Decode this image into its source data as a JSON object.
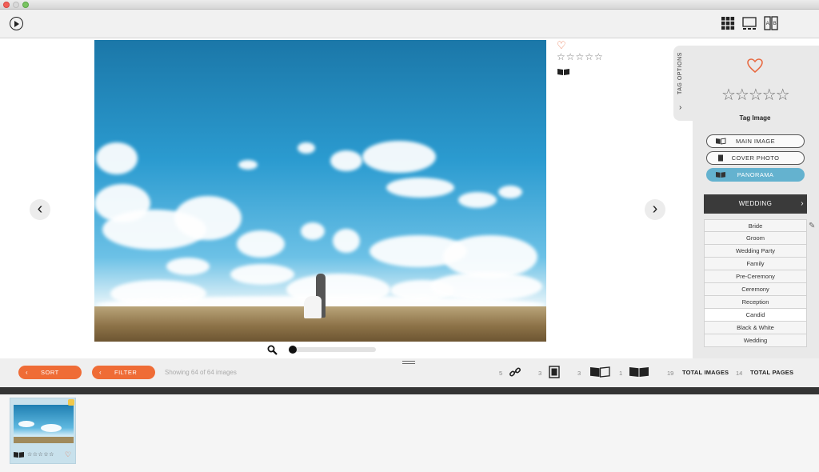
{
  "toolbar": {
    "play_icon": "play-icon",
    "view_icons": [
      "grid-view-icon",
      "single-view-icon",
      "compare-view-icon"
    ]
  },
  "viewer": {
    "prev_arrow": "‹",
    "next_arrow": "›",
    "heart": "♡",
    "stars": "☆☆☆☆☆",
    "zoom_level": 0
  },
  "tag_panel": {
    "tab_label": "TAG OPTIONS",
    "tab_chevron": "›",
    "stars": "☆☆☆☆☆",
    "tag_image_label": "Tag Image",
    "buttons": [
      {
        "label": "MAIN IMAGE"
      },
      {
        "label": "COVER PHOTO"
      },
      {
        "label": "PANORAMA"
      }
    ],
    "category": "WEDDING",
    "category_chevron": "›",
    "tags": [
      "Bride",
      "Groom",
      "Wedding Party",
      "Family",
      "Pre-Ceremony",
      "Ceremony",
      "Reception",
      "Candid",
      "Black & White",
      "Wedding"
    ],
    "selected_tag": "Candid"
  },
  "bottom": {
    "sort_label": "SORT",
    "filter_label": "FILTER",
    "btn_chevron": "‹",
    "showing": "Showing 64 of 64 images",
    "counts": {
      "links": "5",
      "cover": "3",
      "main": "3",
      "panorama": "1",
      "total_images": "19",
      "total_pages": "14"
    },
    "total_images_label": "TOTAL IMAGES",
    "total_pages_label": "TOTAL PAGES"
  },
  "thumbnail": {
    "stars": "☆☆☆☆☆",
    "heart": "♡"
  },
  "colors": {
    "accent_orange": "#ef6c36",
    "accent_blue": "#64b2cf",
    "heart": "#e8683f"
  }
}
